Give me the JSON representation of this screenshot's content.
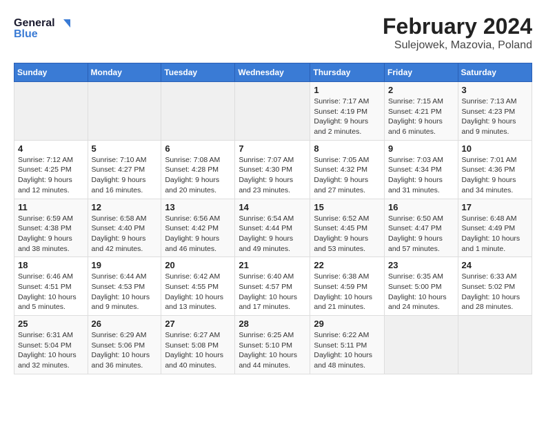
{
  "logo": {
    "line1": "General",
    "line2": "Blue"
  },
  "title": "February 2024",
  "subtitle": "Sulejowek, Mazovia, Poland",
  "days_of_week": [
    "Sunday",
    "Monday",
    "Tuesday",
    "Wednesday",
    "Thursday",
    "Friday",
    "Saturday"
  ],
  "weeks": [
    [
      {
        "day": "",
        "info": ""
      },
      {
        "day": "",
        "info": ""
      },
      {
        "day": "",
        "info": ""
      },
      {
        "day": "",
        "info": ""
      },
      {
        "day": "1",
        "info": "Sunrise: 7:17 AM\nSunset: 4:19 PM\nDaylight: 9 hours and 2 minutes."
      },
      {
        "day": "2",
        "info": "Sunrise: 7:15 AM\nSunset: 4:21 PM\nDaylight: 9 hours and 6 minutes."
      },
      {
        "day": "3",
        "info": "Sunrise: 7:13 AM\nSunset: 4:23 PM\nDaylight: 9 hours and 9 minutes."
      }
    ],
    [
      {
        "day": "4",
        "info": "Sunrise: 7:12 AM\nSunset: 4:25 PM\nDaylight: 9 hours and 12 minutes."
      },
      {
        "day": "5",
        "info": "Sunrise: 7:10 AM\nSunset: 4:27 PM\nDaylight: 9 hours and 16 minutes."
      },
      {
        "day": "6",
        "info": "Sunrise: 7:08 AM\nSunset: 4:28 PM\nDaylight: 9 hours and 20 minutes."
      },
      {
        "day": "7",
        "info": "Sunrise: 7:07 AM\nSunset: 4:30 PM\nDaylight: 9 hours and 23 minutes."
      },
      {
        "day": "8",
        "info": "Sunrise: 7:05 AM\nSunset: 4:32 PM\nDaylight: 9 hours and 27 minutes."
      },
      {
        "day": "9",
        "info": "Sunrise: 7:03 AM\nSunset: 4:34 PM\nDaylight: 9 hours and 31 minutes."
      },
      {
        "day": "10",
        "info": "Sunrise: 7:01 AM\nSunset: 4:36 PM\nDaylight: 9 hours and 34 minutes."
      }
    ],
    [
      {
        "day": "11",
        "info": "Sunrise: 6:59 AM\nSunset: 4:38 PM\nDaylight: 9 hours and 38 minutes."
      },
      {
        "day": "12",
        "info": "Sunrise: 6:58 AM\nSunset: 4:40 PM\nDaylight: 9 hours and 42 minutes."
      },
      {
        "day": "13",
        "info": "Sunrise: 6:56 AM\nSunset: 4:42 PM\nDaylight: 9 hours and 46 minutes."
      },
      {
        "day": "14",
        "info": "Sunrise: 6:54 AM\nSunset: 4:44 PM\nDaylight: 9 hours and 49 minutes."
      },
      {
        "day": "15",
        "info": "Sunrise: 6:52 AM\nSunset: 4:45 PM\nDaylight: 9 hours and 53 minutes."
      },
      {
        "day": "16",
        "info": "Sunrise: 6:50 AM\nSunset: 4:47 PM\nDaylight: 9 hours and 57 minutes."
      },
      {
        "day": "17",
        "info": "Sunrise: 6:48 AM\nSunset: 4:49 PM\nDaylight: 10 hours and 1 minute."
      }
    ],
    [
      {
        "day": "18",
        "info": "Sunrise: 6:46 AM\nSunset: 4:51 PM\nDaylight: 10 hours and 5 minutes."
      },
      {
        "day": "19",
        "info": "Sunrise: 6:44 AM\nSunset: 4:53 PM\nDaylight: 10 hours and 9 minutes."
      },
      {
        "day": "20",
        "info": "Sunrise: 6:42 AM\nSunset: 4:55 PM\nDaylight: 10 hours and 13 minutes."
      },
      {
        "day": "21",
        "info": "Sunrise: 6:40 AM\nSunset: 4:57 PM\nDaylight: 10 hours and 17 minutes."
      },
      {
        "day": "22",
        "info": "Sunrise: 6:38 AM\nSunset: 4:59 PM\nDaylight: 10 hours and 21 minutes."
      },
      {
        "day": "23",
        "info": "Sunrise: 6:35 AM\nSunset: 5:00 PM\nDaylight: 10 hours and 24 minutes."
      },
      {
        "day": "24",
        "info": "Sunrise: 6:33 AM\nSunset: 5:02 PM\nDaylight: 10 hours and 28 minutes."
      }
    ],
    [
      {
        "day": "25",
        "info": "Sunrise: 6:31 AM\nSunset: 5:04 PM\nDaylight: 10 hours and 32 minutes."
      },
      {
        "day": "26",
        "info": "Sunrise: 6:29 AM\nSunset: 5:06 PM\nDaylight: 10 hours and 36 minutes."
      },
      {
        "day": "27",
        "info": "Sunrise: 6:27 AM\nSunset: 5:08 PM\nDaylight: 10 hours and 40 minutes."
      },
      {
        "day": "28",
        "info": "Sunrise: 6:25 AM\nSunset: 5:10 PM\nDaylight: 10 hours and 44 minutes."
      },
      {
        "day": "29",
        "info": "Sunrise: 6:22 AM\nSunset: 5:11 PM\nDaylight: 10 hours and 48 minutes."
      },
      {
        "day": "",
        "info": ""
      },
      {
        "day": "",
        "info": ""
      }
    ]
  ]
}
